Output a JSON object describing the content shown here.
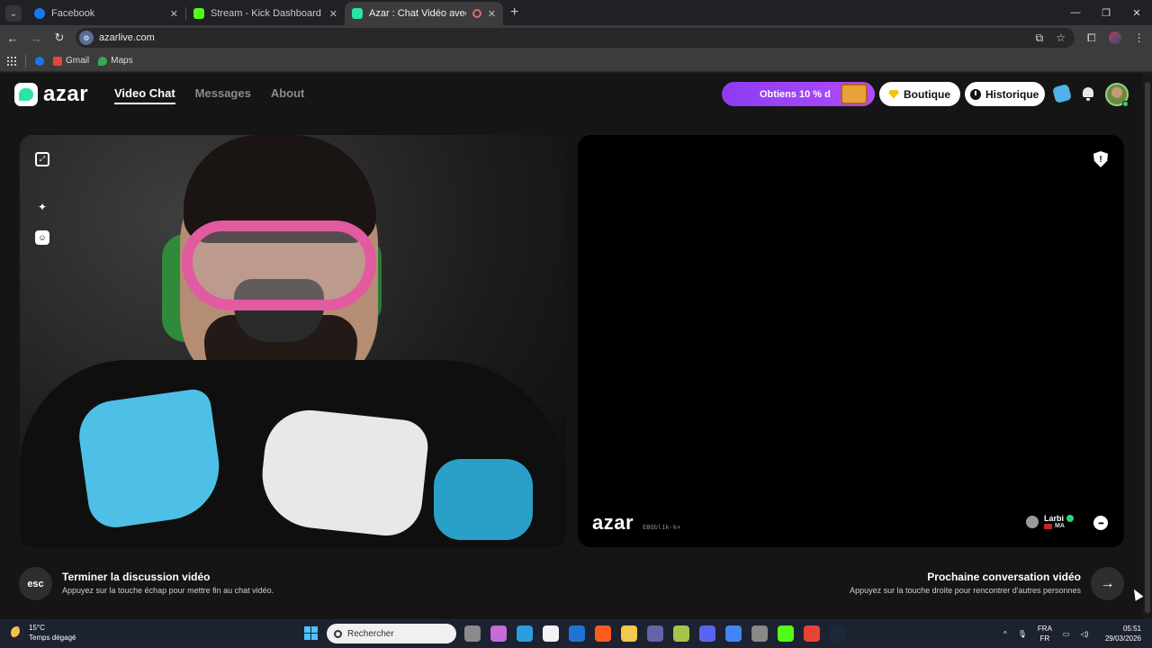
{
  "browser": {
    "tabs": [
      {
        "label": "Facebook",
        "color": "#1877f2",
        "active": false
      },
      {
        "label": "Stream - Kick Dashboard",
        "color": "#53fc18",
        "active": false
      },
      {
        "label": "Azar : Chat Vidéo avec de n",
        "color": "#2be6a3",
        "active": true
      }
    ],
    "new_tab": "+",
    "url": "azarlive.com",
    "bookmarks": [
      {
        "label": "",
        "color": "#1877f2"
      },
      {
        "label": "Gmail",
        "color": "#ea4335"
      },
      {
        "label": "Maps",
        "color": "#34a853"
      }
    ]
  },
  "header": {
    "logo_text": "azar",
    "nav": [
      {
        "label": "Video Chat",
        "active": true
      },
      {
        "label": "Messages",
        "active": false
      },
      {
        "label": "About",
        "active": false
      }
    ],
    "promo_label": "Obtiens 10 % d",
    "boutique_label": "Boutique",
    "historique_label": "Historique"
  },
  "remote": {
    "watermark": "azar",
    "session_id": "EBQbl1k-k+",
    "peer_name": "Larbi",
    "peer_country": "MA"
  },
  "footer": {
    "esc_label": "esc",
    "end_title": "Terminer la discussion vidéo",
    "end_desc": "Appuyez sur la touche échap pour mettre fin au chat vidéo.",
    "next_title": "Prochaine conversation vidéo",
    "next_desc": "Appuyez sur la touche droite pour rencontrer d'autres personnes"
  },
  "taskbar": {
    "temperature": "15°C",
    "weather": "Temps dégagé",
    "search_placeholder": "Rechercher",
    "lang_top": "FRA",
    "lang_bottom": "FR",
    "time": "05:51",
    "date": "29/03/2026",
    "app_colors": [
      "#8a8a8a",
      "#c86ad8",
      "#2d9be0",
      "#f2f2f2",
      "#1f73d6",
      "#ff5a1f",
      "#f2c94c",
      "#6264a7",
      "#a6c44c",
      "#5865f2",
      "#4285f4",
      "#888888",
      "#53fc18",
      "#ea4335",
      "#1b2838"
    ]
  }
}
